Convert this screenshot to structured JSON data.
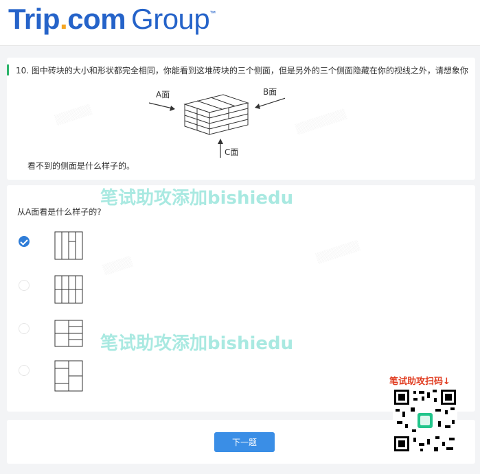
{
  "header": {
    "logo_trip": "Trip",
    "logo_dot": ".",
    "logo_com": "com",
    "logo_group": "Group",
    "logo_tm": "™"
  },
  "question": {
    "text_line1": "10. 图中砖块的大小和形状都完全相同，你能看到这堆砖块的三个侧面，但是另外的三个侧面隐藏在你的视线之外，请想象你",
    "text_line2": "看不到的侧面是什么样子的。",
    "label_a": "A面",
    "label_b": "B面",
    "label_c": "C面"
  },
  "answer": {
    "prompt": "从A面看是什么样子的?",
    "options": [
      {
        "id": "A",
        "selected": true
      },
      {
        "id": "B",
        "selected": false
      },
      {
        "id": "C",
        "selected": false
      },
      {
        "id": "D",
        "selected": false
      }
    ]
  },
  "footer": {
    "next_label": "下一题"
  },
  "watermark": {
    "text": "笔试助攻添加bishiedu",
    "qr_label": "笔试助攻扫码↓"
  },
  "colors": {
    "brand_blue": "#2563c9",
    "button_blue": "#3a8ee6",
    "check_blue": "#2f7dd8",
    "accent_green": "#2bb46a",
    "watermark_teal": "#8ce1d7",
    "qr_red": "#e03a1e"
  }
}
